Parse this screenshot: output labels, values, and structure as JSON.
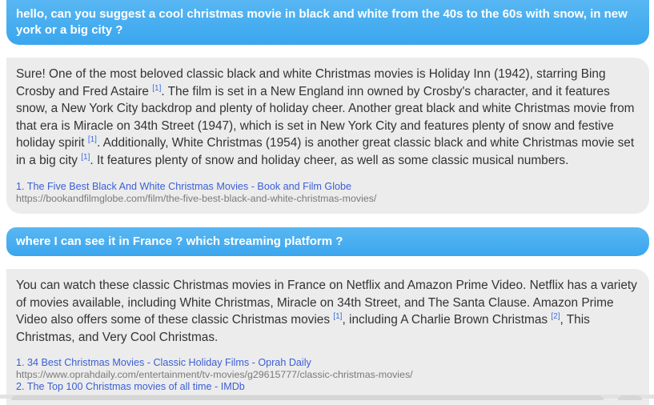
{
  "conversation": [
    {
      "role": "user",
      "text": "hello, can you suggest a cool christmas movie in black and white from the 40s to the 60s with snow, in new york or a big city ?"
    },
    {
      "role": "assistant",
      "segments": [
        "Sure! One of the most beloved classic black and white Christmas movies is Holiday Inn (1942), starring Bing Crosby and Fred Astaire ",
        "[1]",
        ". The film is set in a New England inn owned by Crosby's character, and it features snow, a New York City backdrop and plenty of holiday cheer. Another great black and white Christmas movie from that era is Miracle on 34th Street (1947), which is set in New York City and features plenty of snow and festive holiday spirit ",
        "[1]",
        ". Additionally, White Christmas (1954) is another great classic black and white Christmas movie set in a big city ",
        "[1]",
        ". It features plenty of snow and holiday cheer, as well as some classic musical numbers."
      ],
      "sources": [
        {
          "title": "1. The Five Best Black And White Christmas Movies - Book and Film Globe",
          "url": "https://bookandfilmglobe.com/film/the-five-best-black-and-white-christmas-movies/"
        }
      ]
    },
    {
      "role": "user",
      "text": "where I can see it in France ? which streaming platform ?"
    },
    {
      "role": "assistant",
      "segments": [
        "You can watch these classic Christmas movies in France on Netflix and Amazon Prime Video. Netflix has a variety of movies available, including White Christmas, Miracle on 34th Street, and The Santa Clause. Amazon Prime Video also offers some of these classic Christmas movies ",
        "[1]",
        ", including A Charlie Brown Christmas ",
        "[2]",
        ", This Christmas, and Very Cool Christmas."
      ],
      "sources": [
        {
          "title": "1. 34 Best Christmas Movies - Classic Holiday Films - Oprah Daily",
          "url": "https://www.oprahdaily.com/entertainment/tv-movies/g29615777/classic-christmas-movies/"
        }
      ],
      "truncated_source": "2. The Top 100 Christmas movies of all time - IMDb"
    }
  ]
}
